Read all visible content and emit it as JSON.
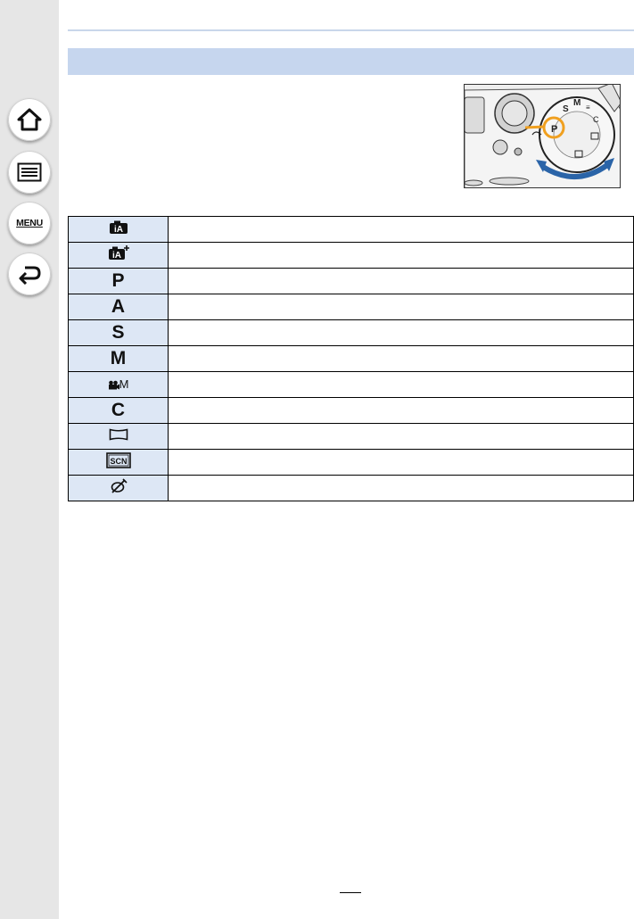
{
  "sidebar": {
    "buttons": [
      {
        "name": "home-icon"
      },
      {
        "name": "contents-list-icon"
      },
      {
        "name": "menu-icon",
        "label": "MENU"
      },
      {
        "name": "back-icon"
      }
    ]
  },
  "header": {
    "title": ""
  },
  "illustration": {
    "dial_letters": [
      "P",
      "S",
      "M"
    ],
    "highlight_color": "#f0a020",
    "arrow_color": "#2a64a8"
  },
  "mode_table": {
    "rows": [
      {
        "icon": "intelligent-auto-icon"
      },
      {
        "icon": "intelligent-auto-plus-icon"
      },
      {
        "icon": "program-ae-icon",
        "symbol": "P"
      },
      {
        "icon": "aperture-priority-icon",
        "symbol": "A"
      },
      {
        "icon": "shutter-priority-icon",
        "symbol": "S"
      },
      {
        "icon": "manual-exposure-icon",
        "symbol": "M"
      },
      {
        "icon": "creative-video-icon",
        "symbol": "M"
      },
      {
        "icon": "custom-icon",
        "symbol": "C"
      },
      {
        "icon": "panorama-icon"
      },
      {
        "icon": "scene-guide-icon",
        "symbol": "SCN"
      },
      {
        "icon": "creative-control-icon"
      }
    ]
  },
  "footer": {
    "page_number": ""
  }
}
